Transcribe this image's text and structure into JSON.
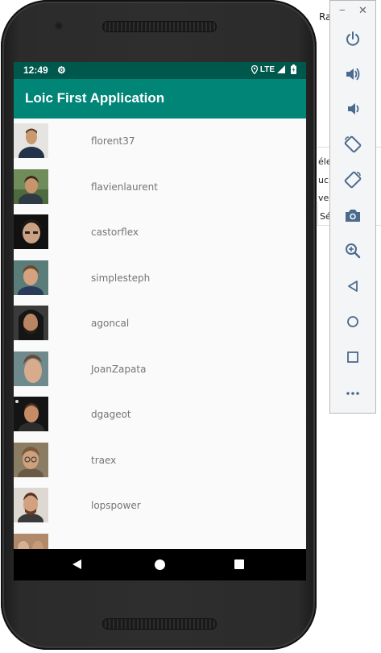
{
  "desktop": {
    "fragments": [
      "Ra",
      "éle",
      "uc",
      "ve",
      "Sé"
    ]
  },
  "status_bar": {
    "time": "12:49",
    "network": "LTE",
    "icons": [
      "gear-icon",
      "location-icon",
      "signal-icon",
      "battery-icon"
    ]
  },
  "app_bar": {
    "title": "Loic First Application"
  },
  "users": [
    {
      "name": "florent37"
    },
    {
      "name": "flavienlaurent"
    },
    {
      "name": "castorflex"
    },
    {
      "name": "simplesteph"
    },
    {
      "name": "agoncal"
    },
    {
      "name": "JoanZapata"
    },
    {
      "name": "dgageot"
    },
    {
      "name": "traex"
    },
    {
      "name": "lopspower"
    },
    {
      "name": ""
    }
  ],
  "nav_bar": {
    "icons": [
      "back-icon",
      "home-icon",
      "recents-icon"
    ]
  },
  "emulator_toolbar": {
    "minimize": "−",
    "close": "✕",
    "buttons": [
      "power-icon",
      "volume-up-icon",
      "volume-down-icon",
      "rotate-left-icon",
      "rotate-right-icon",
      "camera-icon",
      "zoom-icon",
      "back-icon",
      "home-icon",
      "overview-icon",
      "more-icon"
    ]
  },
  "colors": {
    "status_bar": "#00574b",
    "app_bar": "#008577",
    "list_background": "#fafafa",
    "username_text": "#757575",
    "toolbar_icon": "#4a6a8e"
  }
}
